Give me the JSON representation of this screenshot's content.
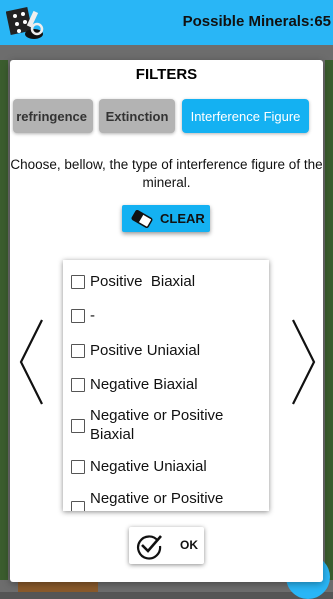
{
  "header": {
    "possible_minerals_label": "Possible Minerals:",
    "possible_minerals_count": "65"
  },
  "dialog": {
    "title": "FILTERS",
    "tabs": [
      {
        "label": "Birefringence",
        "visible_text": "refringence",
        "active": false
      },
      {
        "label": "Extinction",
        "visible_text": "Extinction",
        "active": false
      },
      {
        "label": "Interference Figure",
        "visible_text": "Interference Figure",
        "active": true
      }
    ],
    "description": "Choose, bellow, the type of interference figure of the mineral.",
    "clear_label": "CLEAR",
    "options": [
      {
        "label": "Positive  Biaxial",
        "checked": false
      },
      {
        "label": "-",
        "checked": false
      },
      {
        "label": "Positive Uniaxial",
        "checked": false
      },
      {
        "label": "Negative Biaxial",
        "checked": false
      },
      {
        "label": "Negative or Positive\nBiaxial",
        "checked": false
      },
      {
        "label": "Negative Uniaxial",
        "checked": false
      },
      {
        "label": "Negative or Positive",
        "checked": false
      }
    ],
    "ok_label": "OK"
  },
  "colors": {
    "accent": "#29b6f6",
    "tab_active": "#14b1f2",
    "tab_inactive": "#b3b3b3"
  },
  "icons": [
    "app-logo-icon",
    "eraser-icon",
    "chevron-left-icon",
    "chevron-right-icon",
    "checkmark-circle-icon"
  ]
}
